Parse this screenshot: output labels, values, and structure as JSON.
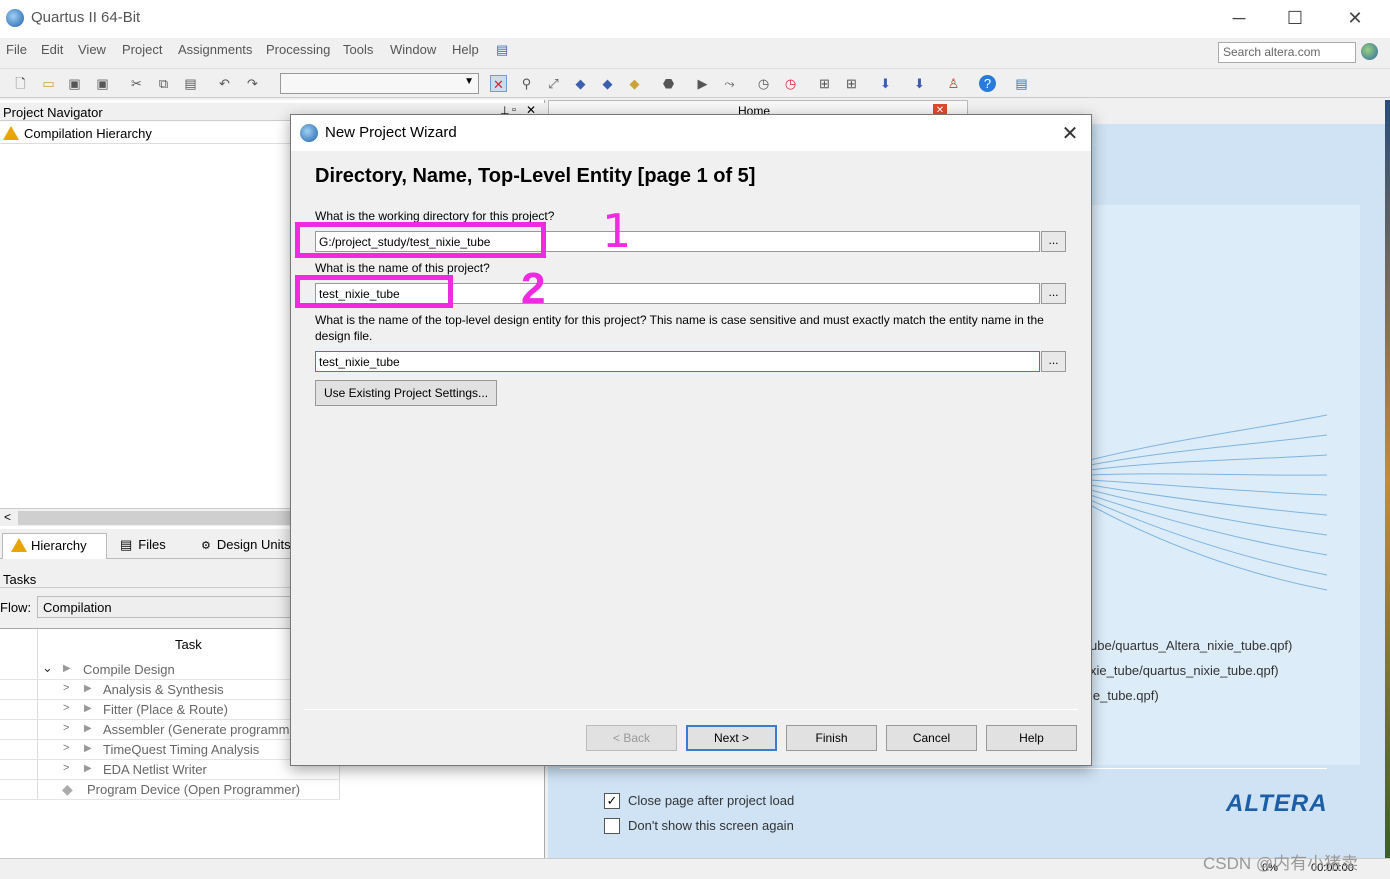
{
  "window": {
    "title": "Quartus II 64-Bit",
    "controls": [
      "─",
      "☐",
      "✕"
    ]
  },
  "menu": [
    "File",
    "Edit",
    "View",
    "Project",
    "Assignments",
    "Processing",
    "Tools",
    "Window",
    "Help"
  ],
  "search": {
    "placeholder": "Search altera.com"
  },
  "navigator": {
    "title": "Project Navigator",
    "selector": "Compilation Hierarchy",
    "tabs": [
      "Hierarchy",
      "Files",
      "Design Units"
    ]
  },
  "tasks": {
    "title": "Tasks",
    "flow_label": "Flow:",
    "flow_value": "Compilation",
    "column": "Task",
    "rows": [
      "Compile Design",
      "Analysis & Synthesis",
      "Fitter (Place & Route)",
      "Assembler (Generate programmi",
      "TimeQuest Timing Analysis",
      "EDA Netlist Writer",
      "Program Device (Open Programmer)"
    ]
  },
  "home": {
    "tab_title": "Home",
    "recent": [
      "ube/quartus_Altera_nixie_tube.qpf)",
      "xie_tube/quartus_nixie_tube.qpf)",
      "ie_tube.qpf)"
    ],
    "close_page_label": "Close page after project load",
    "close_page_checked": true,
    "dont_show_label": "Don't show this screen again",
    "dont_show_checked": false,
    "logo": "ALTERA"
  },
  "dialog": {
    "title": "New Project Wizard",
    "heading": "Directory, Name, Top-Level Entity [page 1 of 5]",
    "q_dir": "What is the working directory for this project?",
    "dir_value": "G:/project_study/test_nixie_tube",
    "q_name": "What is the name of this project?",
    "name_value": "test_nixie_tube",
    "q_entity": "What is the name of the top-level design entity for this project? This name is case sensitive and must exactly match the entity name in the design file.",
    "entity_value": "test_nixie_tube",
    "browse_label": "...",
    "use_existing": "Use Existing Project Settings...",
    "buttons": {
      "back": "< Back",
      "next": "Next >",
      "finish": "Finish",
      "cancel": "Cancel",
      "help": "Help"
    }
  },
  "annotations": {
    "mark1": "1",
    "mark2": "2"
  },
  "status": {
    "progress": "0%",
    "time": "00:00:00"
  },
  "watermark": "CSDN @内有小猪卖",
  "colors": {
    "annotation": "#ee2be0",
    "accent": "#3b7bd4",
    "home_bg": "#cfe3f5"
  }
}
